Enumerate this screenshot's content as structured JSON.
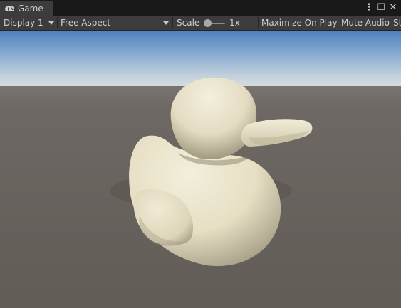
{
  "tab": {
    "title": "Game",
    "icon": "gamepad-icon"
  },
  "window_controls": {
    "more": "⋮",
    "maximize": "☐",
    "close": "✕"
  },
  "toolbar": {
    "display": "Display 1",
    "aspect": "Free Aspect",
    "scale_label": "Scale",
    "scale_value": "1x",
    "scale_slider_level": 0,
    "maximize_on_play": "Maximize On Play",
    "mute_audio": "Mute Audio",
    "truncated": "St"
  },
  "colors": {
    "accent": "#2f6db3",
    "sky_top": "#5f8bc0",
    "sky_horizon": "#c9d6e0",
    "ground": "#6a6560",
    "duck": "#e7e1c8"
  }
}
